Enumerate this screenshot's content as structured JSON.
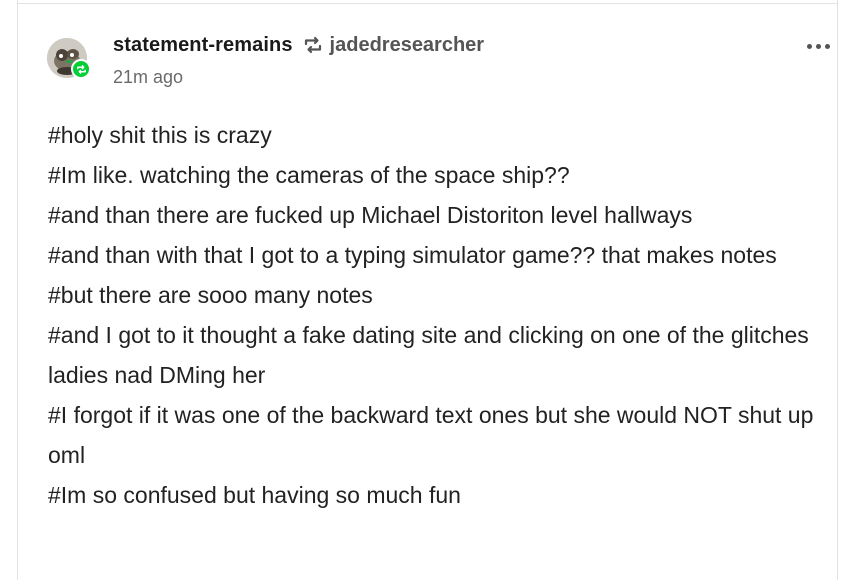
{
  "post": {
    "blog_name": "statement-remains",
    "reblog_icon": "reblog-icon",
    "source_blog": "jadedresearcher",
    "timestamp": "21m ago",
    "more_icon": "more-options-icon",
    "badge_icon": "reblog-badge-icon",
    "accent_color": "#01cf35",
    "tags": [
      "#holy shit this is crazy",
      "#Im like. watching the cameras of the space ship??",
      "#and than there are fucked up Michael Distoriton level hallways",
      "#and than with that I got to a typing simulator game?? that makes notes",
      "#but there are sooo many notes",
      "#and I got to it thought a fake dating site and clicking on one of the glitches ladies nad DMing her",
      "#I forgot if it was one of the backward text ones but she would NOT shut up oml",
      "#Im so confused but having so much fun"
    ]
  }
}
